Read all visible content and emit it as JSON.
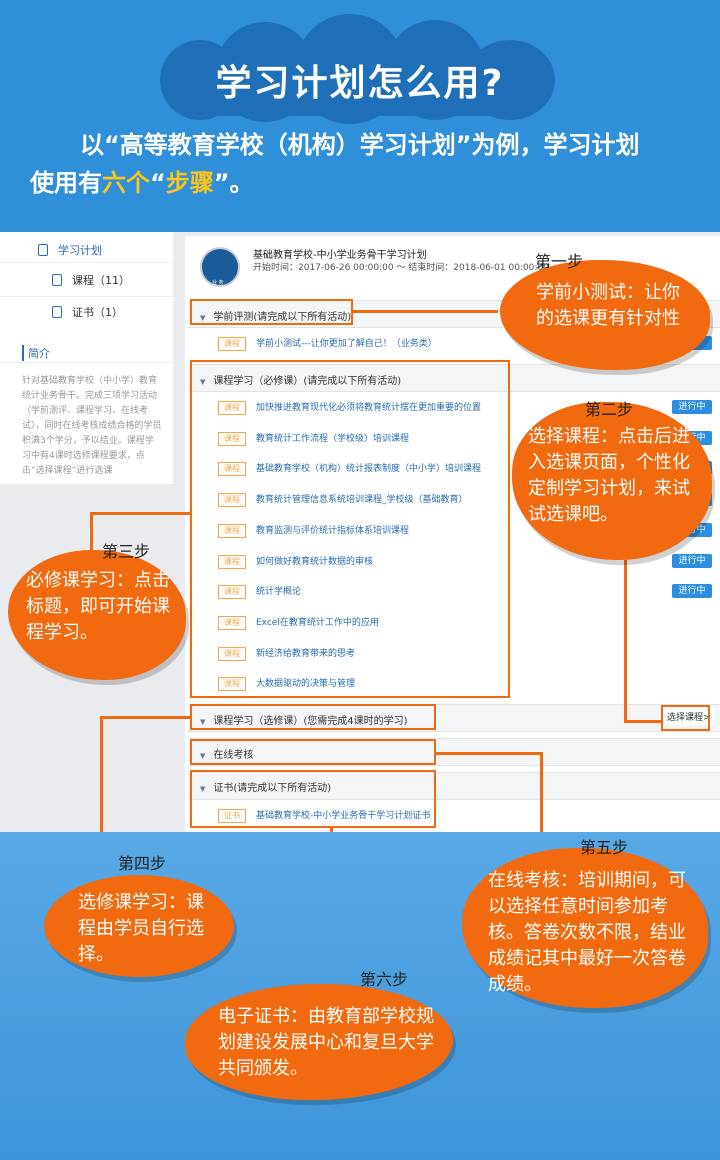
{
  "header": {
    "title": "学习计划怎么用?",
    "intro_line1": "以“高等教育学校（机构）学习计划”为例，学习计划",
    "intro_line2_a": "使用有",
    "intro_line2_b": "六个",
    "intro_line2_c": "“",
    "intro_line2_d": "步骤",
    "intro_line2_e": "”。"
  },
  "sidebar": {
    "plan": "学习计划",
    "courses": "课程（11）",
    "certs": "证书（1）",
    "intro_label": "简介",
    "intro_text": "针对基础教育学校（中小学）教育统计业务骨干。完成三项学习活动（学前测评、课程学习、在线考试），同时在线考核成绩合格的学员积满3个学分，予以结业。课程学习中有4课时选修课程要求，点击“选择课程”进行选课"
  },
  "course": {
    "logo_text": "业 务",
    "title": "基础教育学校-中小学业务骨干学习计划",
    "date": "开始时间：2017-06-26 00:00:00 ～ 结束时间：2018-06-01 00:00:00"
  },
  "sections": {
    "pretest": "学前评测(请完成以下所有活动)",
    "pretest_item": "学前小测试---让你更加了解自己！（业务类）",
    "required": "课程学习（必修课）(请完成以下所有活动)",
    "elective": "课程学习（选修课）(您需完成4课时的学习)",
    "exam": "在线考核",
    "cert": "证书(请完成以下所有活动)",
    "cert_item": "基础教育学校-中小学业务骨干学习计划证书"
  },
  "tags": {
    "course": "课程",
    "cert": "证书"
  },
  "required_courses": [
    "加快推进教育现代化必须将教育统计摆在更加重要的位置",
    "教育统计工作流程（学校级）培训课程",
    "基础教育学校（机构）统计报表制度（中小学）培训课程",
    "教育统计管理信息系统培训课程_学校级（基础教育）",
    "教育监测与评价统计指标体系培训课程",
    "如何做好教育统计数据的审核",
    "统计学概论",
    "Excel在教育统计工作中的应用",
    "新经济给教育带来的思考",
    "大数据驱动的决策与管理"
  ],
  "status": {
    "in_progress": "进行中",
    "done_partial": "成",
    "select_course": "选择课程>"
  },
  "steps": {
    "s1_label": "第一步",
    "s1_text": "学前小测试：让你的选课更有针对性",
    "s2_label": "第二步",
    "s2_text": "选择课程：点击后进入选课页面，个性化定制学习计划，来试试选课吧。",
    "s3_label": "第三步",
    "s3_text": "必修课学习：点击标题，即可开始课程学习。",
    "s4_label": "第四步",
    "s4_text": "选修课学习：课程由学员自行选择。",
    "s5_label": "第五步",
    "s5_text": "在线考核：培训期间，可以选择任意时间参加考核。答卷次数不限，结业成绩记其中最好一次答卷成绩。",
    "s6_label": "第六步",
    "s6_text": "电子证书：由教育部学校规划建设发展中心和复旦大学共同颁发。"
  },
  "colors": {
    "accent_blue": "#2f8fd8",
    "bubble_orange": "#f26a0f",
    "highlight_yellow": "#ffc51a"
  }
}
